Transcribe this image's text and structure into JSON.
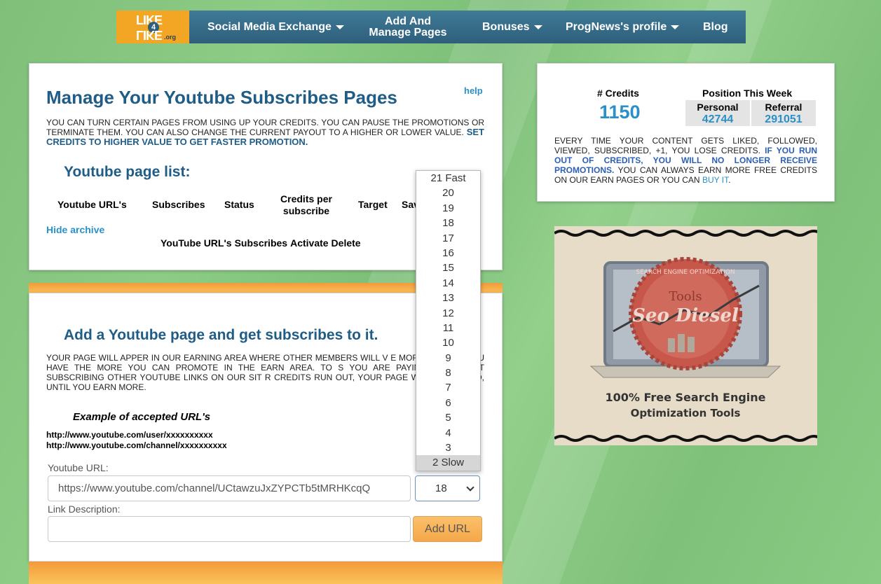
{
  "nav": {
    "logo_line1": "LIKE",
    "logo_line2": "LIKE",
    "logo_num": "4",
    "logo_domain": ".org",
    "items": [
      {
        "label": "Social Media Exchange",
        "has_caret": true
      },
      {
        "label": "Add And Manage Pages",
        "has_caret": false
      },
      {
        "label": "Bonuses",
        "has_caret": true
      },
      {
        "label": "ProgNews's profile",
        "has_caret": true
      },
      {
        "label": "Blog",
        "has_caret": false
      }
    ]
  },
  "manage": {
    "title": "Manage Your Youtube Subscribes Pages",
    "help": "help",
    "desc": "You can turn certain pages from using up your credits. You can pause the promotions or terminate them. You can also change the current payout to a higher or lower value.",
    "desc_highlight": "Set credits to higher value to get faster promotion.",
    "list_title": "Youtube page list:",
    "columns": [
      "Youtube URL's",
      "Subscribes",
      "Status",
      "Credits per subscribe",
      "Target",
      "Sav"
    ],
    "hide_archive": "Hide archive",
    "archive_columns": [
      "YouTube URL's",
      "Subscribes",
      "Activate",
      "Delete"
    ]
  },
  "add": {
    "title": "Add a Youtube page and get subscribes to it.",
    "desc": "Your page will apper in our earning area where other members will v                 e more credits you have the more you can promote in the earn area. To                  s you are paying out, start subscribing other youtube links on our sit                r credits run out, your page will be paused, until you earn more.",
    "example_title": "Example of accepted URL's",
    "example_1": "http://www.youtube.com/user/xxxxxxxxxx",
    "example_2": "http://www.youtube.com/channel/xxxxxxxxxx",
    "url_label": "Youtube URL:",
    "url_value": "https://www.youtube.com/channel/UCtawzuJxZYPCTb5tMRHKcqQ",
    "desc_label": "Link Description:",
    "desc_value": "",
    "credits_selected": "18",
    "add_button": "Add URL"
  },
  "dropdown": {
    "options": [
      "21 Fast",
      "20",
      "19",
      "18",
      "17",
      "16",
      "15",
      "14",
      "13",
      "12",
      "11",
      "10",
      "9",
      "8",
      "7",
      "6",
      "5",
      "4",
      "3",
      "2 Slow"
    ],
    "highlighted": "2 Slow"
  },
  "stats": {
    "credits_label": "# Credits",
    "credits_value": "1150",
    "position_label": "Position This Week",
    "personal_label": "Personal",
    "personal_value": "42744",
    "referral_label": "Referral",
    "referral_value": "291051",
    "note_1": "Every time your content gets liked, followed, viewed, subscribed, +1, you lose credits.",
    "note_highlight": "If you run out of credits, you will no longer receive promotions.",
    "note_2": "You can always earn more free credits on our earn pages or you can",
    "buy_link": "Buy it",
    "note_end": "."
  },
  "ad": {
    "arc_text": "SEARCH ENGINE OPTIMIZATION",
    "tools": "Tools",
    "brand": "Seo Diesel",
    "tagline_1": "100% Free Search Engine",
    "tagline_2": "Optimization Tools"
  },
  "colors": {
    "nav": "#2e5f7c",
    "logo": "#f3a623",
    "heading": "#1f5c86",
    "link": "#2a90c8",
    "accent_orange": "#f5a74a"
  }
}
